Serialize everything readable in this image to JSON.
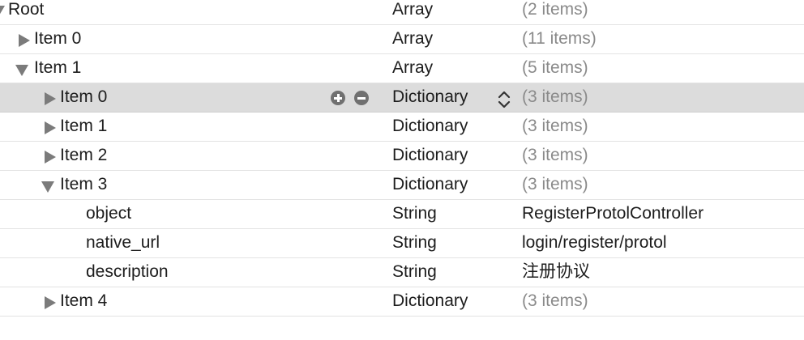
{
  "plist": {
    "rows": [
      {
        "key": "Root",
        "type": "Array",
        "value": "(2 items)"
      },
      {
        "key": "Item 0",
        "type": "Array",
        "value": "(11 items)"
      },
      {
        "key": "Item 1",
        "type": "Array",
        "value": "(5 items)"
      },
      {
        "key": "Item 0",
        "type": "Dictionary",
        "value": "(3 items)"
      },
      {
        "key": "Item 1",
        "type": "Dictionary",
        "value": "(3 items)"
      },
      {
        "key": "Item 2",
        "type": "Dictionary",
        "value": "(3 items)"
      },
      {
        "key": "Item 3",
        "type": "Dictionary",
        "value": "(3 items)"
      },
      {
        "key": "object",
        "type": "String",
        "value": "RegisterProtolController"
      },
      {
        "key": "native_url",
        "type": "String",
        "value": "login/register/protol"
      },
      {
        "key": "description",
        "type": "String",
        "value": "注册协议"
      },
      {
        "key": "Item 4",
        "type": "Dictionary",
        "value": "(3 items)"
      }
    ]
  },
  "icons": {
    "add_row": "plus-circle-icon",
    "remove_row": "minus-circle-icon",
    "type_stepper": "up-down-chevron-icon",
    "collapsed": "disclosure-triangle-right-icon",
    "expanded": "disclosure-triangle-down-icon"
  },
  "colors": {
    "selected_row_background": "#dcdcdc",
    "count_text": "#8a8a8a",
    "text": "#1d1d1d"
  }
}
